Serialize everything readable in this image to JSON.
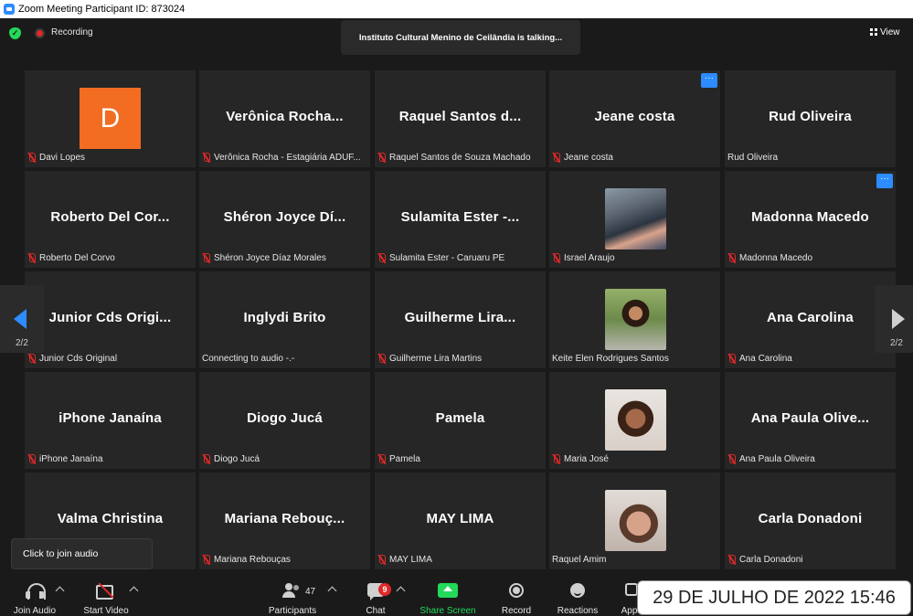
{
  "window": {
    "title": "Zoom Meeting Participant ID: 873024"
  },
  "topbar": {
    "recording_label": "Recording",
    "talking_banner": "Instituto Cultural Menino de Ceilândia is talking...",
    "view_label": "View"
  },
  "pager": {
    "left_page": "2/2",
    "right_page": "2/2"
  },
  "tiles": [
    {
      "big": "",
      "label": "Davi Lopes",
      "muted": true,
      "avatar_letter": "D"
    },
    {
      "big": "Verônica  Rocha...",
      "label": "Verônica Rocha - Estagiária ADUF...",
      "muted": true
    },
    {
      "big": "Raquel  Santos  d...",
      "label": "Raquel Santos de Souza Machado",
      "muted": true
    },
    {
      "big": "Jeane  costa",
      "label": "Jeane costa",
      "muted": true,
      "more": "···"
    },
    {
      "big": "Rud  Oliveira",
      "label": "Rud Oliveira",
      "muted": false
    },
    {
      "big": "Roberto  Del  Cor...",
      "label": "Roberto Del Corvo",
      "muted": true
    },
    {
      "big": "Shéron  Joyce  Dí...",
      "label": "Shéron Joyce Díaz Morales",
      "muted": true
    },
    {
      "big": "Sulamita  Ester  -...",
      "label": "Sulamita Ester - Caruaru PE",
      "muted": true
    },
    {
      "big": "",
      "label": "Israel Araujo",
      "muted": true,
      "photo": "photo1"
    },
    {
      "big": "Madonna  Macedo",
      "label": "Madonna Macedo",
      "muted": true,
      "more": "···"
    },
    {
      "big": "Junior  Cds  Origi...",
      "label": "Junior Cds Original",
      "muted": true
    },
    {
      "big": "Inglydi  Brito",
      "label": "Connecting to audio -.-",
      "muted": false
    },
    {
      "big": "Guilherme  Lira...",
      "label": "Guilherme Lira Martins",
      "muted": true
    },
    {
      "big": "",
      "label": "Keite Elen Rodrigues Santos",
      "muted": false,
      "photo": "photo2"
    },
    {
      "big": "Ana  Carolina",
      "label": "Ana Carolina",
      "muted": true
    },
    {
      "big": "iPhone  Janaína",
      "label": "iPhone Janaína",
      "muted": true
    },
    {
      "big": "Diogo  Jucá",
      "label": "Diogo Jucá",
      "muted": true
    },
    {
      "big": "Pamela",
      "label": "Pamela",
      "muted": true
    },
    {
      "big": "",
      "label": "Maria José",
      "muted": true,
      "photo": "photo3"
    },
    {
      "big": "Ana  Paula  Olive...",
      "label": "Ana Paula Oliveira",
      "muted": true
    },
    {
      "big": "Valma  Christina",
      "label": "",
      "muted": false
    },
    {
      "big": "Mariana  Rebouç...",
      "label": "Mariana Rebouças",
      "muted": true
    },
    {
      "big": "MAY  LIMA",
      "label": "MAY LIMA",
      "muted": true
    },
    {
      "big": "",
      "label": "Raquel Amim",
      "muted": false,
      "photo": "photo4"
    },
    {
      "big": "Carla  Donadoni",
      "label": "Carla Donadoni",
      "muted": true
    }
  ],
  "tooltip": {
    "text": "Click to join audio"
  },
  "toolbar": {
    "join_audio": "Join Audio",
    "start_video": "Start Video",
    "participants": "Participants",
    "participant_count": "47",
    "chat": "Chat",
    "chat_badge": "9",
    "share_screen": "Share Screen",
    "record": "Record",
    "reactions": "Reactions",
    "apps": "Apps"
  },
  "timestamp": "29 DE JULHO DE 2022 15:46",
  "colors": {
    "accent": "#2d8cff",
    "share": "#23d959",
    "muted": "#e02828",
    "avatar": "#f26d22"
  }
}
